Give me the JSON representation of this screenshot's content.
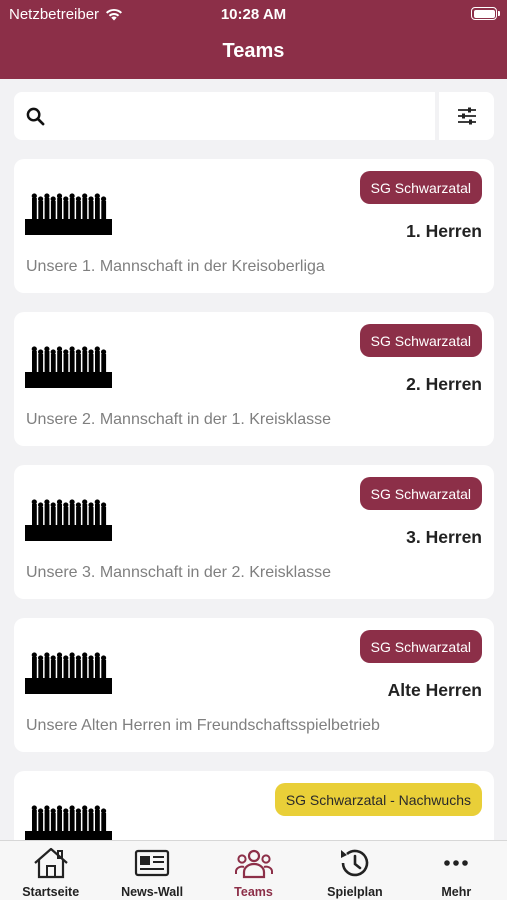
{
  "status_bar": {
    "carrier": "Netzbetreiber",
    "time": "10:28 AM"
  },
  "header": {
    "title": "Teams"
  },
  "search": {
    "placeholder": "",
    "value": ""
  },
  "colors": {
    "brand": "#8c2f48",
    "youth_badge": "#e9cf38",
    "background": "#f2f2f4"
  },
  "teams": [
    {
      "badge": "SG Schwarzatal",
      "badge_style": "main",
      "name": "1. Herren",
      "description": "Unsere 1. Mannschaft in der Kreisoberliga"
    },
    {
      "badge": "SG Schwarzatal",
      "badge_style": "main",
      "name": "2. Herren",
      "description": "Unsere 2. Mannschaft in der 1. Kreisklasse"
    },
    {
      "badge": "SG Schwarzatal",
      "badge_style": "main",
      "name": "3. Herren",
      "description": "Unsere 3. Mannschaft in der 2. Kreisklasse"
    },
    {
      "badge": "SG Schwarzatal",
      "badge_style": "main",
      "name": "Alte Herren",
      "description": "Unsere Alten Herren im Freundschaftsspielbetrieb"
    },
    {
      "badge": "SG Schwarzatal - Nachwuchs",
      "badge_style": "youth",
      "name": "",
      "description": ""
    }
  ],
  "tabbar": [
    {
      "label": "Startseite",
      "icon": "home-icon",
      "active": false
    },
    {
      "label": "News-Wall",
      "icon": "newspaper-icon",
      "active": false
    },
    {
      "label": "Teams",
      "icon": "people-icon",
      "active": true
    },
    {
      "label": "Spielplan",
      "icon": "clock-history-icon",
      "active": false
    },
    {
      "label": "Mehr",
      "icon": "more-dots-icon",
      "active": false
    }
  ]
}
